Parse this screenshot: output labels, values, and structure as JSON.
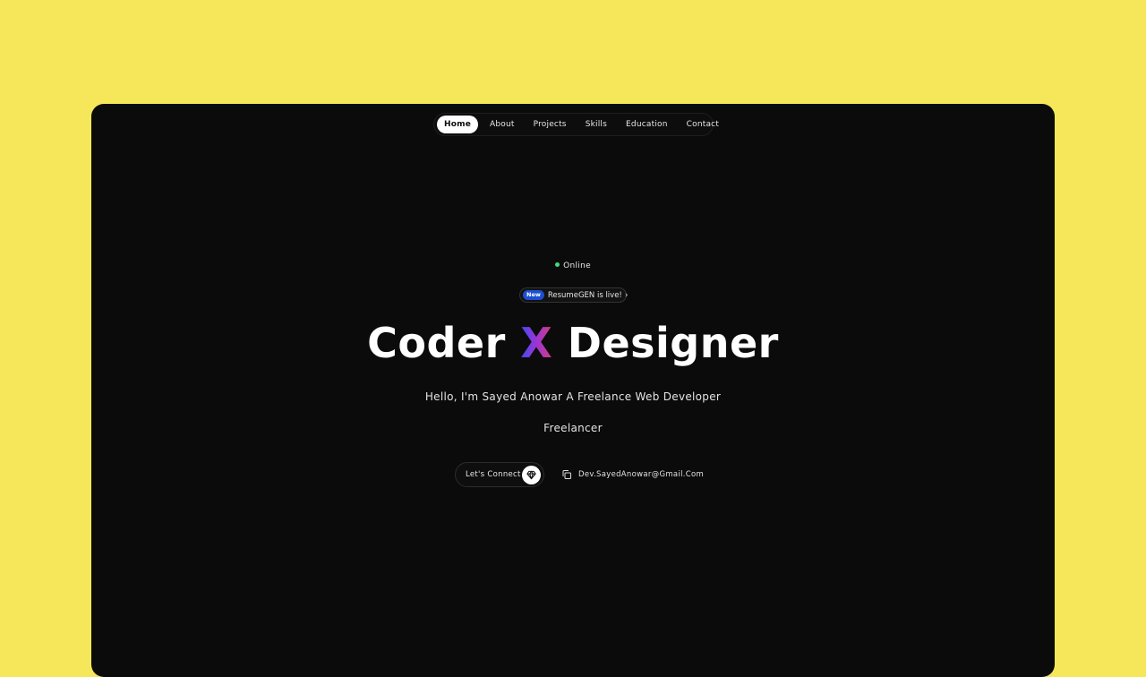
{
  "nav": {
    "items": [
      {
        "label": "Home",
        "active": true
      },
      {
        "label": "About",
        "active": false
      },
      {
        "label": "Projects",
        "active": false
      },
      {
        "label": "Skills",
        "active": false
      },
      {
        "label": "Education",
        "active": false
      },
      {
        "label": "Contact",
        "active": false
      }
    ]
  },
  "status": {
    "label": "Online",
    "color": "#3ddc84"
  },
  "announcement": {
    "badge": "New",
    "text": "ResumeGEN is live!",
    "icon": "chevron-right-icon"
  },
  "hero": {
    "title_before": "Coder ",
    "title_highlight": "X",
    "title_after": " Designer",
    "subtitle": "Hello, I'm Sayed Anowar A Freelance Web Developer",
    "role": "Freelancer"
  },
  "actions": {
    "connect_label": "Let's Connect",
    "connect_icon": "gem-icon",
    "email": "Dev.SayedAnowar@Gmail.Com",
    "email_icon": "copy-icon"
  },
  "colors": {
    "page_background": "#f6e75a",
    "frame_background": "#0b0b0b",
    "badge_blue": "#1d4fd1",
    "gradient": [
      "#3b4cf0",
      "#9a35d6",
      "#d43d7a"
    ]
  }
}
